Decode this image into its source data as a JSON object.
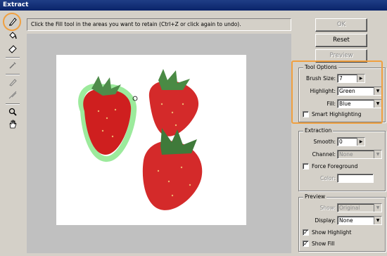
{
  "window": {
    "title": "Extract"
  },
  "instructions": "Click the Fill tool in the areas you want to retain (Ctrl+Z or click again to undo).",
  "tools": [
    {
      "name": "edge-highlighter-icon"
    },
    {
      "name": "fill-icon"
    },
    {
      "name": "eraser-icon"
    },
    {
      "name": "eyedropper-icon"
    },
    {
      "name": "cleanup-icon"
    },
    {
      "name": "edge-touchup-icon"
    },
    {
      "name": "zoom-icon"
    },
    {
      "name": "hand-icon"
    }
  ],
  "buttons": {
    "ok": "OK",
    "reset": "Reset",
    "preview": "Preview"
  },
  "tool_options": {
    "title": "Tool Options",
    "brush_size_label": "Brush Size:",
    "brush_size_value": "7",
    "highlight_label": "Highlight:",
    "highlight_value": "Green",
    "fill_label": "Fill:",
    "fill_value": "Blue",
    "smart_highlighting_label": "Smart Highlighting",
    "smart_highlighting_checked": false
  },
  "extraction": {
    "title": "Extraction",
    "smooth_label": "Smooth:",
    "smooth_value": "0",
    "channel_label": "Channel:",
    "channel_value": "None",
    "force_foreground_label": "Force Foreground",
    "force_foreground_checked": false,
    "color_label": "Color:"
  },
  "preview": {
    "title": "Preview",
    "show_label": "Show:",
    "show_value": "Original",
    "display_label": "Display:",
    "display_value": "None",
    "show_highlight_label": "Show Highlight",
    "show_highlight_checked": true,
    "show_fill_label": "Show Fill",
    "show_fill_checked": true
  },
  "colors": {
    "accent_callout": "#f0a040",
    "highlight_green": "#7ee07e",
    "strawberry": "#d42a2a"
  },
  "checkmark": "✓"
}
